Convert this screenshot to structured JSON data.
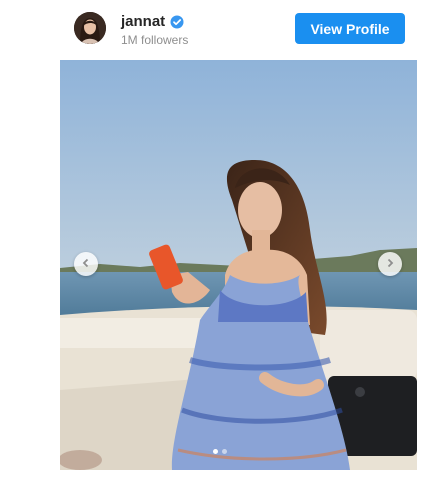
{
  "account": {
    "username": "jannat",
    "followers": "1M followers",
    "verified_icon": "verified-badge-icon",
    "badge_color": "#3897f0"
  },
  "actions": {
    "view_profile_label": "View Profile",
    "button_color": "#1a8ff0"
  },
  "carousel": {
    "prev_icon": "chevron-left-icon",
    "next_icon": "chevron-right-icon",
    "slide_count": 2,
    "active_slide": 1
  }
}
